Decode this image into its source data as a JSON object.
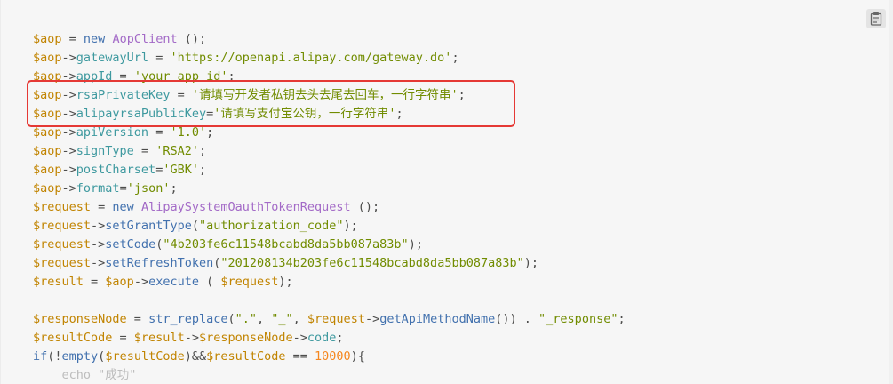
{
  "code_block": {
    "copy_icon": "clipboard-icon",
    "lines": [
      [
        [
          "tv",
          "$aop"
        ],
        [
          "tp",
          " = "
        ],
        [
          "tk",
          "new"
        ],
        [
          "tp",
          " "
        ],
        [
          "tf",
          "AopClient"
        ],
        [
          "tp",
          " ();"
        ]
      ],
      [
        [
          "tv",
          "$aop"
        ],
        [
          "tp",
          "->"
        ],
        [
          "tprop",
          "gatewayUrl"
        ],
        [
          "tp",
          " = "
        ],
        [
          "ts",
          "'https://openapi.alipay.com/gateway.do'"
        ],
        [
          "tp",
          ";"
        ]
      ],
      [
        [
          "tv",
          "$aop"
        ],
        [
          "tp",
          "->"
        ],
        [
          "tprop",
          "appId"
        ],
        [
          "tp",
          " = "
        ],
        [
          "ts",
          "'your app id'"
        ],
        [
          "tp",
          ";"
        ]
      ],
      [
        [
          "tv",
          "$aop"
        ],
        [
          "tp",
          "->"
        ],
        [
          "tprop",
          "rsaPrivateKey"
        ],
        [
          "tp",
          " = "
        ],
        [
          "ts",
          "'请填写开发者私钥去头去尾去回车，一行字符串'"
        ],
        [
          "tp",
          ";"
        ]
      ],
      [
        [
          "tv",
          "$aop"
        ],
        [
          "tp",
          "->"
        ],
        [
          "tprop",
          "alipayrsaPublicKey"
        ],
        [
          "tp",
          "="
        ],
        [
          "ts",
          "'请填写支付宝公钥，一行字符串'"
        ],
        [
          "tp",
          ";"
        ]
      ],
      [
        [
          "tv",
          "$aop"
        ],
        [
          "tp",
          "->"
        ],
        [
          "tprop",
          "apiVersion"
        ],
        [
          "tp",
          " = "
        ],
        [
          "ts",
          "'1.0'"
        ],
        [
          "tp",
          ";"
        ]
      ],
      [
        [
          "tv",
          "$aop"
        ],
        [
          "tp",
          "->"
        ],
        [
          "tprop",
          "signType"
        ],
        [
          "tp",
          " = "
        ],
        [
          "ts",
          "'RSA2'"
        ],
        [
          "tp",
          ";"
        ]
      ],
      [
        [
          "tv",
          "$aop"
        ],
        [
          "tp",
          "->"
        ],
        [
          "tprop",
          "postCharset"
        ],
        [
          "tp",
          "="
        ],
        [
          "ts",
          "'GBK'"
        ],
        [
          "tp",
          ";"
        ]
      ],
      [
        [
          "tv",
          "$aop"
        ],
        [
          "tp",
          "->"
        ],
        [
          "tprop",
          "format"
        ],
        [
          "tp",
          "="
        ],
        [
          "ts",
          "'json'"
        ],
        [
          "tp",
          ";"
        ]
      ],
      [
        [
          "tv",
          "$request"
        ],
        [
          "tp",
          " = "
        ],
        [
          "tk",
          "new"
        ],
        [
          "tp",
          " "
        ],
        [
          "tf",
          "AlipaySystemOauthTokenRequest"
        ],
        [
          "tp",
          " ();"
        ]
      ],
      [
        [
          "tv",
          "$request"
        ],
        [
          "tp",
          "->"
        ],
        [
          "tm",
          "setGrantType"
        ],
        [
          "tp",
          "("
        ],
        [
          "ts",
          "\"authorization_code\""
        ],
        [
          "tp",
          ");"
        ]
      ],
      [
        [
          "tv",
          "$request"
        ],
        [
          "tp",
          "->"
        ],
        [
          "tm",
          "setCode"
        ],
        [
          "tp",
          "("
        ],
        [
          "ts",
          "\"4b203fe6c11548bcabd8da5bb087a83b\""
        ],
        [
          "tp",
          ");"
        ]
      ],
      [
        [
          "tv",
          "$request"
        ],
        [
          "tp",
          "->"
        ],
        [
          "tm",
          "setRefreshToken"
        ],
        [
          "tp",
          "("
        ],
        [
          "ts",
          "\"201208134b203fe6c11548bcabd8da5bb087a83b\""
        ],
        [
          "tp",
          ");"
        ]
      ],
      [
        [
          "tv",
          "$result"
        ],
        [
          "tp",
          " = "
        ],
        [
          "tv",
          "$aop"
        ],
        [
          "tp",
          "->"
        ],
        [
          "tm",
          "execute"
        ],
        [
          "tp",
          " ( "
        ],
        [
          "tv",
          "$request"
        ],
        [
          "tp",
          ");"
        ]
      ],
      [
        [
          "tp",
          ""
        ]
      ],
      [
        [
          "tv",
          "$responseNode"
        ],
        [
          "tp",
          " = "
        ],
        [
          "tk",
          "str_replace"
        ],
        [
          "tp",
          "("
        ],
        [
          "ts",
          "\".\""
        ],
        [
          "tp",
          ", "
        ],
        [
          "ts",
          "\"_\""
        ],
        [
          "tp",
          ", "
        ],
        [
          "tv",
          "$request"
        ],
        [
          "tp",
          "->"
        ],
        [
          "tm",
          "getApiMethodName"
        ],
        [
          "tp",
          "()) . "
        ],
        [
          "ts",
          "\"_response\""
        ],
        [
          "tp",
          ";"
        ]
      ],
      [
        [
          "tv",
          "$resultCode"
        ],
        [
          "tp",
          " = "
        ],
        [
          "tv",
          "$result"
        ],
        [
          "tp",
          "->"
        ],
        [
          "tv",
          "$responseNode"
        ],
        [
          "tp",
          "->"
        ],
        [
          "tprop",
          "code"
        ],
        [
          "tp",
          ";"
        ]
      ],
      [
        [
          "tk",
          "if"
        ],
        [
          "tp",
          "(!"
        ],
        [
          "tk",
          "empty"
        ],
        [
          "tp",
          "("
        ],
        [
          "tv",
          "$resultCode"
        ],
        [
          "tp",
          ")&&"
        ],
        [
          "tv",
          "$resultCode"
        ],
        [
          "tp",
          " == "
        ],
        [
          "tn",
          "10000"
        ],
        [
          "tp",
          "){"
        ]
      ],
      [
        [
          "cut",
          "    echo \"成功\""
        ]
      ]
    ]
  }
}
